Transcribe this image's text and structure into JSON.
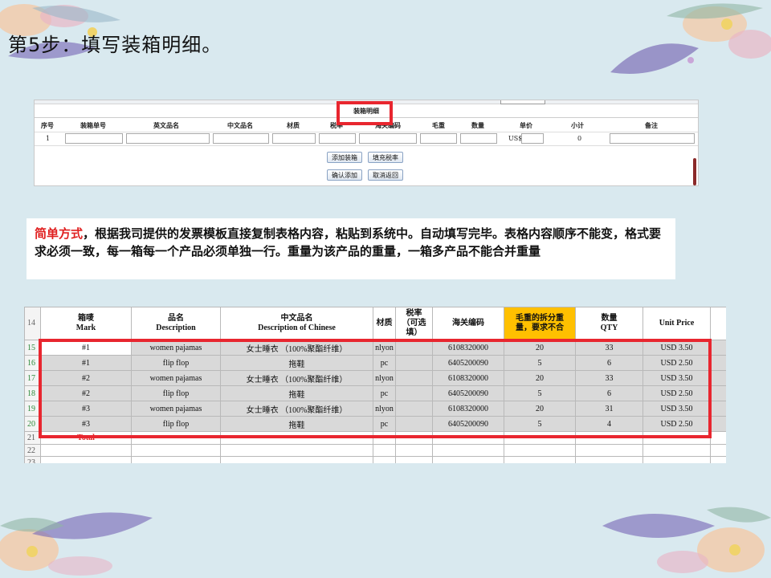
{
  "slide": {
    "title": "第5步：填写装箱明细。"
  },
  "form": {
    "heading": "装箱明细",
    "columns": [
      "序号",
      "装箱单号",
      "英文品名",
      "中文品名",
      "材质",
      "税率",
      "海关编码",
      "毛重",
      "数量",
      "单价",
      "小计",
      "备注"
    ],
    "row": {
      "index": "1",
      "currency": "US$",
      "subtotal": "0"
    },
    "buttons": {
      "add_box": "添加装箱",
      "fill_tax": "填充税率",
      "confirm_add": "确认添加",
      "cancel_back": "取消返回"
    }
  },
  "note": {
    "lead": "简单方式",
    "body": "，根据我司提供的发票模板直接复制表格内容，粘贴到系统中。自动填写完毕。表格内容顺序不能变，格式要求必须一致，每一箱每一个产品必须单独一行。重量为该产品的重量，一箱多产品不能合并重量"
  },
  "sheet": {
    "header_row_num": "14",
    "headers": {
      "mark": "箱唛\nMark",
      "desc": "品名\nDescription",
      "desc_cn": "中文品名\nDescription of Chinese",
      "material": "材质",
      "tax": "税率\n（可选\n填）",
      "hs": "海关编码",
      "weight": "毛重的拆分重\n量，要求不合",
      "qty": "数量\nQTY",
      "price": "Unit Price"
    },
    "rows": [
      {
        "num": "15",
        "mark": "#1",
        "desc": "women pajamas",
        "desc_cn": "女士睡衣 （100%聚酯纤维）",
        "material": "nlyon",
        "tax": "",
        "hs": "6108320000",
        "weight": "20",
        "qty": "33",
        "price": "USD 3.50"
      },
      {
        "num": "16",
        "mark": "#1",
        "desc": "flip flop",
        "desc_cn": "拖鞋",
        "material": "pc",
        "tax": "",
        "hs": "6405200090",
        "weight": "5",
        "qty": "6",
        "price": "USD 2.50"
      },
      {
        "num": "17",
        "mark": "#2",
        "desc": "women pajamas",
        "desc_cn": "女士睡衣 （100%聚酯纤维）",
        "material": "nlyon",
        "tax": "",
        "hs": "6108320000",
        "weight": "20",
        "qty": "33",
        "price": "USD 3.50"
      },
      {
        "num": "18",
        "mark": "#2",
        "desc": "flip flop",
        "desc_cn": "拖鞋",
        "material": "pc",
        "tax": "",
        "hs": "6405200090",
        "weight": "5",
        "qty": "6",
        "price": "USD 2.50"
      },
      {
        "num": "19",
        "mark": "#3",
        "desc": "women pajamas",
        "desc_cn": "女士睡衣 （100%聚酯纤维）",
        "material": "nlyon",
        "tax": "",
        "hs": "6108320000",
        "weight": "20",
        "qty": "31",
        "price": "USD 3.50"
      },
      {
        "num": "20",
        "mark": "#3",
        "desc": "flip flop",
        "desc_cn": "拖鞋",
        "material": "pc",
        "tax": "",
        "hs": "6405200090",
        "weight": "5",
        "qty": "4",
        "price": "USD 2.50"
      }
    ],
    "total_row": {
      "num": "21",
      "label": "Total"
    },
    "empty_rows": [
      "22",
      "23"
    ]
  },
  "colors": {
    "highlight": "#e8262f",
    "background": "#d9e9ef",
    "header_orange": "#ffc000",
    "note_red": "#e02020"
  }
}
